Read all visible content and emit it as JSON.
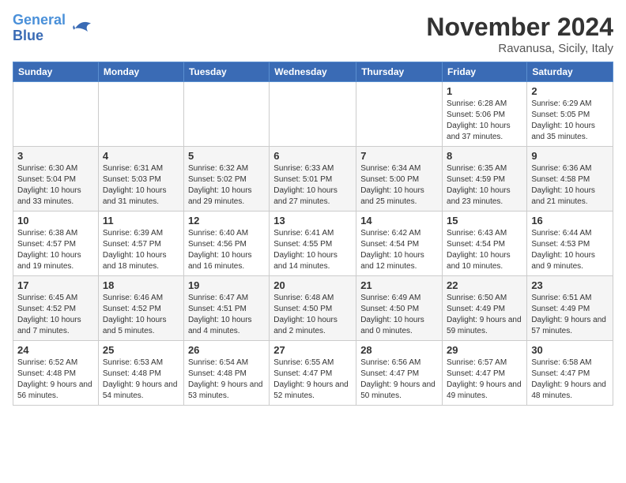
{
  "header": {
    "logo_line1": "General",
    "logo_line2": "Blue",
    "month": "November 2024",
    "location": "Ravanusa, Sicily, Italy"
  },
  "weekdays": [
    "Sunday",
    "Monday",
    "Tuesday",
    "Wednesday",
    "Thursday",
    "Friday",
    "Saturday"
  ],
  "weeks": [
    [
      {
        "day": "",
        "info": ""
      },
      {
        "day": "",
        "info": ""
      },
      {
        "day": "",
        "info": ""
      },
      {
        "day": "",
        "info": ""
      },
      {
        "day": "",
        "info": ""
      },
      {
        "day": "1",
        "info": "Sunrise: 6:28 AM\nSunset: 5:06 PM\nDaylight: 10 hours and 37 minutes."
      },
      {
        "day": "2",
        "info": "Sunrise: 6:29 AM\nSunset: 5:05 PM\nDaylight: 10 hours and 35 minutes."
      }
    ],
    [
      {
        "day": "3",
        "info": "Sunrise: 6:30 AM\nSunset: 5:04 PM\nDaylight: 10 hours and 33 minutes."
      },
      {
        "day": "4",
        "info": "Sunrise: 6:31 AM\nSunset: 5:03 PM\nDaylight: 10 hours and 31 minutes."
      },
      {
        "day": "5",
        "info": "Sunrise: 6:32 AM\nSunset: 5:02 PM\nDaylight: 10 hours and 29 minutes."
      },
      {
        "day": "6",
        "info": "Sunrise: 6:33 AM\nSunset: 5:01 PM\nDaylight: 10 hours and 27 minutes."
      },
      {
        "day": "7",
        "info": "Sunrise: 6:34 AM\nSunset: 5:00 PM\nDaylight: 10 hours and 25 minutes."
      },
      {
        "day": "8",
        "info": "Sunrise: 6:35 AM\nSunset: 4:59 PM\nDaylight: 10 hours and 23 minutes."
      },
      {
        "day": "9",
        "info": "Sunrise: 6:36 AM\nSunset: 4:58 PM\nDaylight: 10 hours and 21 minutes."
      }
    ],
    [
      {
        "day": "10",
        "info": "Sunrise: 6:38 AM\nSunset: 4:57 PM\nDaylight: 10 hours and 19 minutes."
      },
      {
        "day": "11",
        "info": "Sunrise: 6:39 AM\nSunset: 4:57 PM\nDaylight: 10 hours and 18 minutes."
      },
      {
        "day": "12",
        "info": "Sunrise: 6:40 AM\nSunset: 4:56 PM\nDaylight: 10 hours and 16 minutes."
      },
      {
        "day": "13",
        "info": "Sunrise: 6:41 AM\nSunset: 4:55 PM\nDaylight: 10 hours and 14 minutes."
      },
      {
        "day": "14",
        "info": "Sunrise: 6:42 AM\nSunset: 4:54 PM\nDaylight: 10 hours and 12 minutes."
      },
      {
        "day": "15",
        "info": "Sunrise: 6:43 AM\nSunset: 4:54 PM\nDaylight: 10 hours and 10 minutes."
      },
      {
        "day": "16",
        "info": "Sunrise: 6:44 AM\nSunset: 4:53 PM\nDaylight: 10 hours and 9 minutes."
      }
    ],
    [
      {
        "day": "17",
        "info": "Sunrise: 6:45 AM\nSunset: 4:52 PM\nDaylight: 10 hours and 7 minutes."
      },
      {
        "day": "18",
        "info": "Sunrise: 6:46 AM\nSunset: 4:52 PM\nDaylight: 10 hours and 5 minutes."
      },
      {
        "day": "19",
        "info": "Sunrise: 6:47 AM\nSunset: 4:51 PM\nDaylight: 10 hours and 4 minutes."
      },
      {
        "day": "20",
        "info": "Sunrise: 6:48 AM\nSunset: 4:50 PM\nDaylight: 10 hours and 2 minutes."
      },
      {
        "day": "21",
        "info": "Sunrise: 6:49 AM\nSunset: 4:50 PM\nDaylight: 10 hours and 0 minutes."
      },
      {
        "day": "22",
        "info": "Sunrise: 6:50 AM\nSunset: 4:49 PM\nDaylight: 9 hours and 59 minutes."
      },
      {
        "day": "23",
        "info": "Sunrise: 6:51 AM\nSunset: 4:49 PM\nDaylight: 9 hours and 57 minutes."
      }
    ],
    [
      {
        "day": "24",
        "info": "Sunrise: 6:52 AM\nSunset: 4:48 PM\nDaylight: 9 hours and 56 minutes."
      },
      {
        "day": "25",
        "info": "Sunrise: 6:53 AM\nSunset: 4:48 PM\nDaylight: 9 hours and 54 minutes."
      },
      {
        "day": "26",
        "info": "Sunrise: 6:54 AM\nSunset: 4:48 PM\nDaylight: 9 hours and 53 minutes."
      },
      {
        "day": "27",
        "info": "Sunrise: 6:55 AM\nSunset: 4:47 PM\nDaylight: 9 hours and 52 minutes."
      },
      {
        "day": "28",
        "info": "Sunrise: 6:56 AM\nSunset: 4:47 PM\nDaylight: 9 hours and 50 minutes."
      },
      {
        "day": "29",
        "info": "Sunrise: 6:57 AM\nSunset: 4:47 PM\nDaylight: 9 hours and 49 minutes."
      },
      {
        "day": "30",
        "info": "Sunrise: 6:58 AM\nSunset: 4:47 PM\nDaylight: 9 hours and 48 minutes."
      }
    ]
  ]
}
